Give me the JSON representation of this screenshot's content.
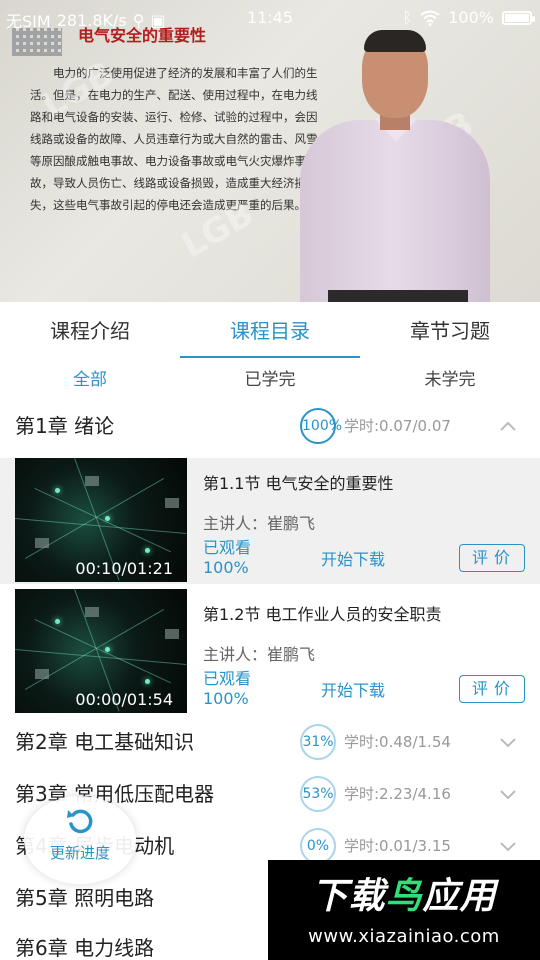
{
  "status_bar": {
    "carrier": "无SIM",
    "speed": "281.8K/s",
    "time": "11:45",
    "battery": "100%"
  },
  "video": {
    "slide_title": "电气安全的重要性",
    "slide_text": "电力的广泛使用促进了经济的发展和丰富了人们的生活。但是，在电力的生产、配送、使用过程中，在电力线路和电气设备的安装、运行、检修、试验的过程中，会因线路或设备的故障、人员违章行为或大自然的雷击、风雪等原因酿成触电事故、电力设备事故或电气火灾爆炸事故，导致人员伤亡、线路或设备损毁，造成重大经济损失，这些电气事故引起的停电还会造成更严重的后果。",
    "watermark": "LGB"
  },
  "tabs": [
    {
      "label": "课程介绍"
    },
    {
      "label": "课程目录"
    },
    {
      "label": "章节习题"
    }
  ],
  "filters": [
    {
      "label": "全部"
    },
    {
      "label": "已学完"
    },
    {
      "label": "未学完"
    }
  ],
  "chapters": [
    {
      "title": "第1章  绪论",
      "percent": "100%",
      "hours": "学时:0.07/0.07"
    },
    {
      "title": "第2章  电工基础知识",
      "percent": "31%",
      "hours": "学时:0.48/1.54"
    },
    {
      "title": "第3章  常用低压配电器",
      "percent": "53%",
      "hours": "学时:2.23/4.16"
    },
    {
      "title": "第4章  异步电动机",
      "percent": "0%",
      "hours": "学时:0.01/3.15"
    },
    {
      "title": "第5章  照明电路"
    },
    {
      "title": "第6章  电力线路"
    }
  ],
  "lessons": [
    {
      "title": "第1.1节  电气安全的重要性",
      "lecturer": "主讲人：崔鹏飞",
      "watched_label": "已观看",
      "watched_pct": "100%",
      "download": "开始下载",
      "rate": "评价",
      "time": "00:10/01:21"
    },
    {
      "title": "第1.2节  电工作业人员的安全职责",
      "lecturer": "主讲人：崔鹏飞",
      "watched_label": "已观看",
      "watched_pct": "100%",
      "download": "开始下载",
      "rate": "评价",
      "time": "00:00/01:54"
    }
  ],
  "refresh": {
    "label": "更新进度"
  },
  "banner": {
    "title_part1": "下载",
    "title_part2": "鸟",
    "title_part3": "应用",
    "url": "www.xiazainiao.com"
  },
  "colors": {
    "accent": "#2a93c9",
    "banner_green": "#2fe07a"
  }
}
